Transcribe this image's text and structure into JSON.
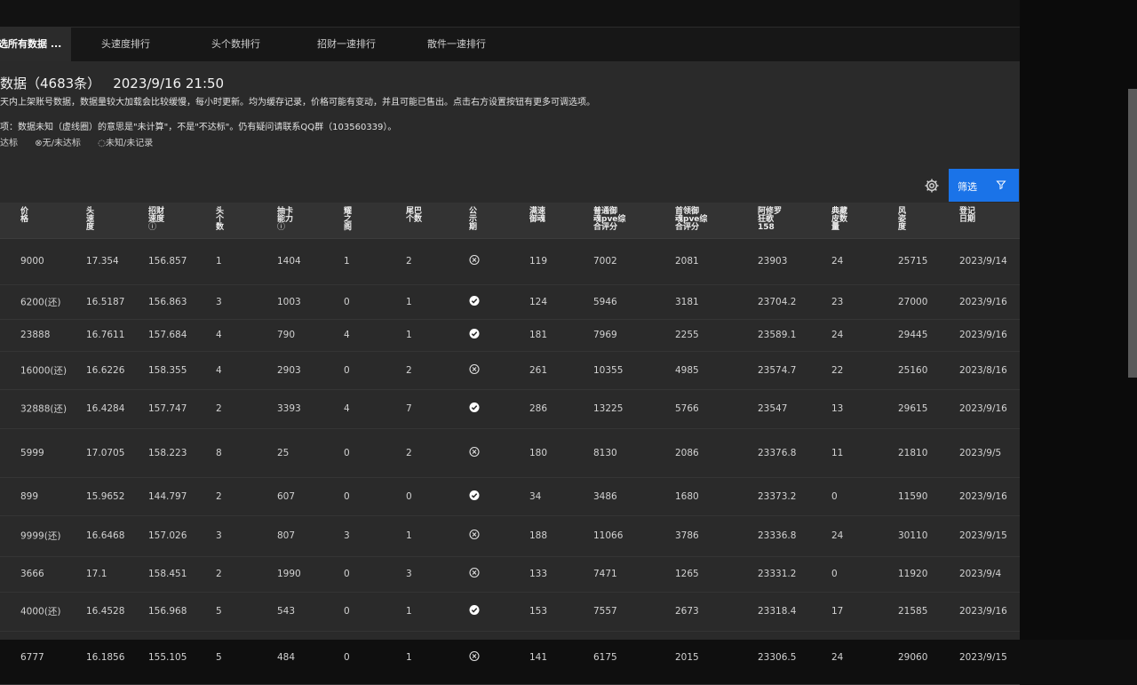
{
  "tabs": [
    {
      "label": "选所有数据 ..."
    },
    {
      "label": "头速度排行"
    },
    {
      "label": "头个数排行"
    },
    {
      "label": "招财一速排行"
    },
    {
      "label": "散件一速排行"
    }
  ],
  "header": {
    "title": "数据（4683条）",
    "timestamp": "2023/9/16 21:50",
    "desc1": "天内上架账号数据，数据量较大加载会比较缓慢，每小时更新。均为缓存记录，价格可能有变动，并且可能已售出。点击右方设置按钮有更多可调选项。",
    "desc2": "项：数据未知（虚线圈）的意思是\"未计算\"，不是\"不达标\"。仍有疑问请联系QQ群（103560339）。",
    "legend": [
      "达标",
      "⊗无/未达标",
      "◌未知/未记录"
    ]
  },
  "toolbar": {
    "filter_label": "筛选"
  },
  "icons": {
    "gear": "gear-icon",
    "filter": "filter-funnel-icon",
    "ok": "check-circle-icon",
    "no": "cross-circle-icon"
  },
  "colors": {
    "accent": "#1a73e8",
    "panel": "#2a2a2a",
    "header": "#333333"
  },
  "columns": [
    {
      "label": "价\n格"
    },
    {
      "label": "头\n速\n度"
    },
    {
      "label": "招财\n速度",
      "info": "ⓘ"
    },
    {
      "label": "头\n个\n数"
    },
    {
      "label": "抽卡\n能力",
      "info": "ⓘ"
    },
    {
      "label": "耀\n之\n阁"
    },
    {
      "label": "尾巴\n个数"
    },
    {
      "label": "公\n示\n期"
    },
    {
      "label": "满速\n御魂"
    },
    {
      "label": "普通御\n魂pve综\n合评分"
    },
    {
      "label": "首领御\n魂pve综\n合评分"
    },
    {
      "label": "阿修罗\n狂歌\n158"
    },
    {
      "label": "典藏\n皮数\n量"
    },
    {
      "label": "风\n姿\n度"
    },
    {
      "label": "登记\n日期"
    }
  ],
  "rows": [
    {
      "price": "9000",
      "head_speed": "17.354",
      "zhaocai": "156.857",
      "head_count": "1",
      "gacha": "1404",
      "yaozhige": "1",
      "tail": "2",
      "status": "no",
      "full_speed": "119",
      "pve_normal": "7002",
      "pve_boss": "2081",
      "ashura": "23903",
      "skins": "24",
      "fengzi": "25715",
      "date": "2023/9/14"
    },
    {
      "price": "6200(还)",
      "head_speed": "16.5187",
      "zhaocai": "156.863",
      "head_count": "3",
      "gacha": "1003",
      "yaozhige": "0",
      "tail": "1",
      "status": "ok",
      "full_speed": "124",
      "pve_normal": "5946",
      "pve_boss": "3181",
      "ashura": "23704.2",
      "skins": "23",
      "fengzi": "27000",
      "date": "2023/9/16"
    },
    {
      "price": "23888",
      "head_speed": "16.7611",
      "zhaocai": "157.684",
      "head_count": "4",
      "gacha": "790",
      "yaozhige": "4",
      "tail": "1",
      "status": "ok",
      "full_speed": "181",
      "pve_normal": "7969",
      "pve_boss": "2255",
      "ashura": "23589.1",
      "skins": "24",
      "fengzi": "29445",
      "date": "2023/9/16"
    },
    {
      "price": "16000(还)",
      "head_speed": "16.6226",
      "zhaocai": "158.355",
      "head_count": "4",
      "gacha": "2903",
      "yaozhige": "0",
      "tail": "2",
      "status": "no",
      "full_speed": "261",
      "pve_normal": "10355",
      "pve_boss": "4985",
      "ashura": "23574.7",
      "skins": "22",
      "fengzi": "25160",
      "date": "2023/8/16"
    },
    {
      "price": "32888(还)",
      "head_speed": "16.4284",
      "zhaocai": "157.747",
      "head_count": "2",
      "gacha": "3393",
      "yaozhige": "4",
      "tail": "7",
      "status": "ok",
      "full_speed": "286",
      "pve_normal": "13225",
      "pve_boss": "5766",
      "ashura": "23547",
      "skins": "13",
      "fengzi": "29615",
      "date": "2023/9/16"
    },
    {
      "price": "5999",
      "head_speed": "17.0705",
      "zhaocai": "158.223",
      "head_count": "8",
      "gacha": "25",
      "yaozhige": "0",
      "tail": "2",
      "status": "no",
      "full_speed": "180",
      "pve_normal": "8130",
      "pve_boss": "2086",
      "ashura": "23376.8",
      "skins": "11",
      "fengzi": "21810",
      "date": "2023/9/5"
    },
    {
      "price": "899",
      "head_speed": "15.9652",
      "zhaocai": "144.797",
      "head_count": "2",
      "gacha": "607",
      "yaozhige": "0",
      "tail": "0",
      "status": "ok",
      "full_speed": "34",
      "pve_normal": "3486",
      "pve_boss": "1680",
      "ashura": "23373.2",
      "skins": "0",
      "fengzi": "11590",
      "date": "2023/9/16"
    },
    {
      "price": "9999(还)",
      "head_speed": "16.6468",
      "zhaocai": "157.026",
      "head_count": "3",
      "gacha": "807",
      "yaozhige": "3",
      "tail": "1",
      "status": "no",
      "full_speed": "188",
      "pve_normal": "11066",
      "pve_boss": "3786",
      "ashura": "23336.8",
      "skins": "24",
      "fengzi": "30110",
      "date": "2023/9/15"
    },
    {
      "price": "3666",
      "head_speed": "17.1",
      "zhaocai": "158.451",
      "head_count": "2",
      "gacha": "1990",
      "yaozhige": "0",
      "tail": "3",
      "status": "no",
      "full_speed": "133",
      "pve_normal": "7471",
      "pve_boss": "1265",
      "ashura": "23331.2",
      "skins": "0",
      "fengzi": "11920",
      "date": "2023/9/4"
    },
    {
      "price": "4000(还)",
      "head_speed": "16.4528",
      "zhaocai": "156.968",
      "head_count": "5",
      "gacha": "543",
      "yaozhige": "0",
      "tail": "1",
      "status": "ok",
      "full_speed": "153",
      "pve_normal": "7557",
      "pve_boss": "2673",
      "ashura": "23318.4",
      "skins": "17",
      "fengzi": "21585",
      "date": "2023/9/16"
    },
    {
      "price": "6777",
      "head_speed": "16.1856",
      "zhaocai": "155.105",
      "head_count": "5",
      "gacha": "484",
      "yaozhige": "0",
      "tail": "1",
      "status": "no",
      "full_speed": "141",
      "pve_normal": "6175",
      "pve_boss": "2015",
      "ashura": "23306.5",
      "skins": "24",
      "fengzi": "29060",
      "date": "2023/9/15"
    }
  ]
}
